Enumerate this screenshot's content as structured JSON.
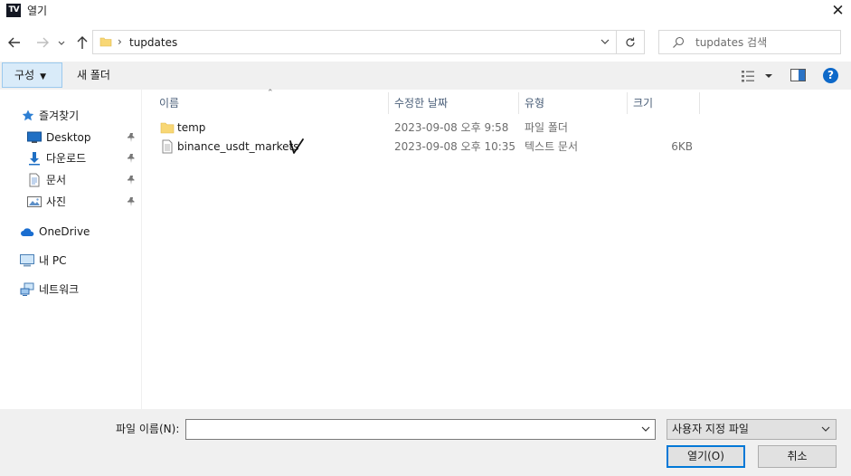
{
  "titlebar": {
    "logo_text": "TV",
    "title": "열기",
    "close_glyph": "✕"
  },
  "address": {
    "separator": "›",
    "path": "tupdates",
    "search_placeholder": "tupdates 검색"
  },
  "toolbar": {
    "organize_label": "구성",
    "new_folder_label": "새 폴더",
    "help_glyph": "?"
  },
  "sidebar": {
    "items": [
      {
        "label": "즐겨찾기",
        "icon": "star-icon",
        "pinned": false
      },
      {
        "label": "Desktop",
        "icon": "desktop-icon",
        "pinned": true
      },
      {
        "label": "다운로드",
        "icon": "download-icon",
        "pinned": true
      },
      {
        "label": "문서",
        "icon": "document-icon",
        "pinned": true
      },
      {
        "label": "사진",
        "icon": "pictures-icon",
        "pinned": true
      },
      {
        "label": "OneDrive",
        "icon": "cloud-icon",
        "pinned": false
      },
      {
        "label": "내 PC",
        "icon": "computer-icon",
        "pinned": false
      },
      {
        "label": "네트워크",
        "icon": "network-icon",
        "pinned": false
      }
    ]
  },
  "filelist": {
    "columns": [
      "이름",
      "수정한 날짜",
      "유형",
      "크기"
    ],
    "rows": [
      {
        "name": "temp",
        "modified": "2023-09-08 오후 9:58",
        "type": "파일 폴더",
        "size": "",
        "icon": "folder-icon"
      },
      {
        "name": "binance_usdt_markets",
        "modified": "2023-09-08 오후 10:35",
        "type": "텍스트 문서",
        "size": "6KB",
        "icon": "text-file-icon"
      }
    ]
  },
  "bottom": {
    "filename_label": "파일 이름(N):",
    "filename_value": "",
    "filetype": "사용자 지정 파일",
    "open_label": "열기(O)",
    "cancel_label": "취소"
  }
}
